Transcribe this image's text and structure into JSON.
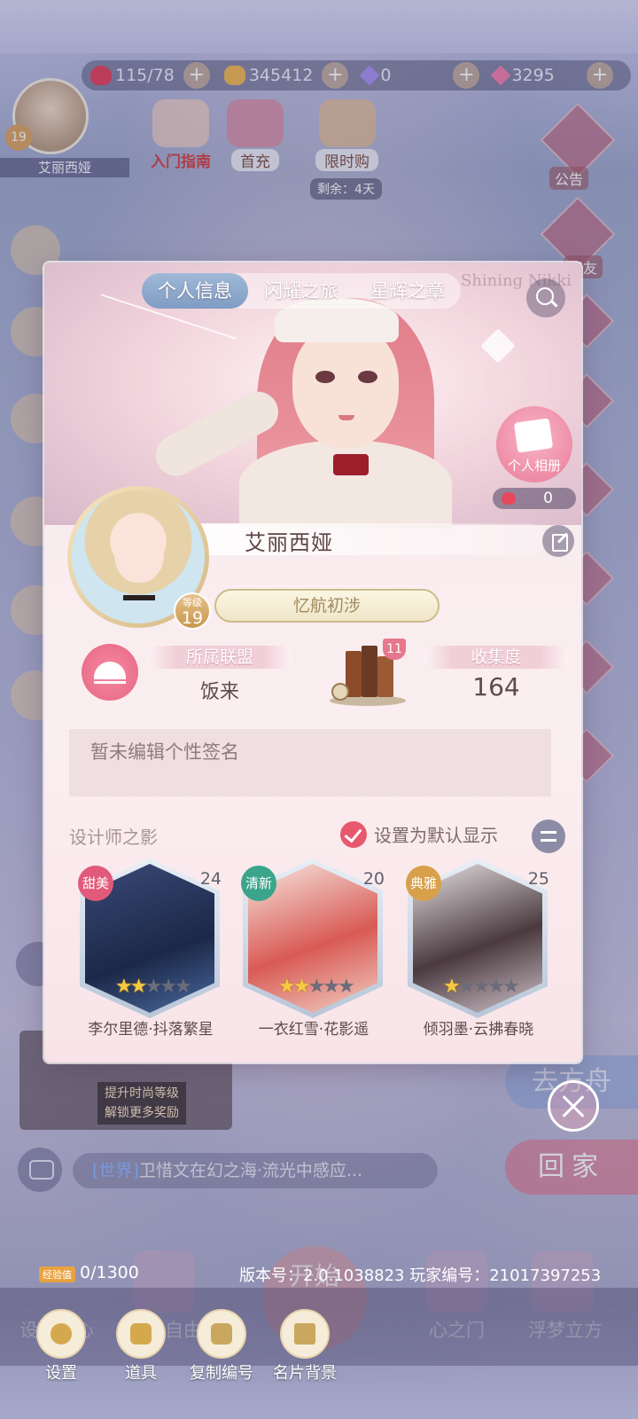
{
  "resources": {
    "stamina": "115/78",
    "gold": "345412",
    "diamond": "0",
    "crystal": "3295"
  },
  "background": {
    "player_name": "艾丽西娅",
    "player_level": "19",
    "level_label": "等级",
    "top_buttons": [
      "入门指南",
      "首充",
      "限时购"
    ],
    "limited_remaining": "剩余：4天",
    "side_labels": [
      "公告",
      "好友"
    ],
    "watermark": "Shining Nikki",
    "chat_channel": "[世界]",
    "chat_message": "卫惜文在幻之海·流光中感应...",
    "promo_line1": "提升时尚等级",
    "promo_line2": "解锁更多奖励",
    "boat_label": "去方舟",
    "home_label": "回家",
    "start_label": "开始",
    "dock_labels": [
      "设计中心",
      "自由换装",
      "心之门",
      "浮梦立方"
    ]
  },
  "card": {
    "tabs": [
      "个人信息",
      "闪耀之旅",
      "星辉之章"
    ],
    "active_tab": 0,
    "album_label": "个人相册",
    "likes": "0",
    "name": "艾丽西娅",
    "level_label": "等级",
    "level": "19",
    "title": "忆航初涉",
    "alliance_label": "所属联盟",
    "alliance_value": "饭来",
    "book_badge": "11",
    "collection_label": "收集度",
    "collection_value": "164",
    "signature": "暂未编辑个性签名",
    "designer_title": "设计师之影",
    "default_display_label": "设置为默认显示",
    "designers": [
      {
        "tag": "甜美",
        "level": "24",
        "name": "李尔里德·抖落繁星",
        "stars": 2,
        "tag_color": "#e15a7a",
        "art": "linear-gradient(160deg,#3a4a78,#1c2848 60%,#4a6aa0)"
      },
      {
        "tag": "清新",
        "level": "20",
        "name": "一衣红雪·花影遥",
        "stars": 2,
        "tag_color": "#3aa58a",
        "art": "linear-gradient(160deg,#f6e7e0,#d95a55 55%,#f0d0c4)"
      },
      {
        "tag": "典雅",
        "level": "25",
        "name": "倾羽墨·云拂春晓",
        "stars": 1,
        "tag_color": "#d8a04a",
        "art": "linear-gradient(160deg,#e8e2e4,#4a3a40 55%,#cfc2c8)"
      }
    ]
  },
  "footer": {
    "exp_tag": "经验值",
    "exp_value": "0/1300",
    "version": "版本号：2.0.1038823  玩家编号：21017397253",
    "tools": [
      "设置",
      "道具",
      "复制编号",
      "名片背景"
    ]
  }
}
